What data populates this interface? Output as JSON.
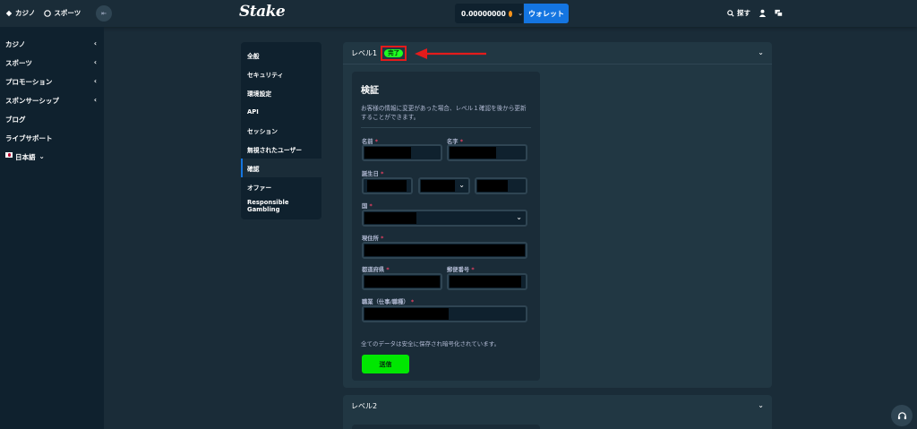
{
  "topbar": {
    "casino_label": "カジノ",
    "sports_label": "スポーツ",
    "collapse_glyph": "⇤",
    "logo": "Stake",
    "balance": "0.00000000",
    "wallet_label": "ウォレット",
    "search_label": "探す"
  },
  "sidebar": {
    "items": [
      {
        "label": "カジノ",
        "chevron": "‹"
      },
      {
        "label": "スポーツ",
        "chevron": "‹"
      },
      {
        "label": "プロモーション",
        "chevron": "‹"
      },
      {
        "label": "スポンサーシップ",
        "chevron": "‹"
      },
      {
        "label": "ブログ"
      },
      {
        "label": "ライブサポート"
      },
      {
        "label": "日本語",
        "chevron": "⌄"
      }
    ]
  },
  "settings_nav": {
    "items": [
      {
        "label": "全般"
      },
      {
        "label": "セキュリティ"
      },
      {
        "label": "環境設定"
      },
      {
        "label": "API"
      },
      {
        "label": "セッション"
      },
      {
        "label": "無視されたユーザー"
      },
      {
        "label": "確認",
        "active": true
      },
      {
        "label": "オファー"
      },
      {
        "label": "Responsible Gambling"
      }
    ]
  },
  "level1": {
    "title": "レベル1",
    "badge": "完了",
    "form": {
      "title": "検証",
      "description": "お客様の情報に変更があった場合、レベル１確認を後から更新することができます。",
      "fields": {
        "last_name": "名前",
        "first_name": "名字",
        "dob": "誕生日",
        "country": "国",
        "address": "現住所",
        "prefecture": "都道府県",
        "postal": "郵便番号",
        "occupation": "職業（仕事/職種）"
      },
      "required_mark": "*",
      "note": "全てのデータは安全に保存され暗号化されています。",
      "submit_label": "送信"
    }
  },
  "level2": {
    "title": "レベル2"
  },
  "colors": {
    "background": "#1a2c38",
    "sidebar": "#0f212e",
    "accent_blue": "#1475e1",
    "success_green": "#00e701",
    "highlight_red": "#e41b1b"
  }
}
